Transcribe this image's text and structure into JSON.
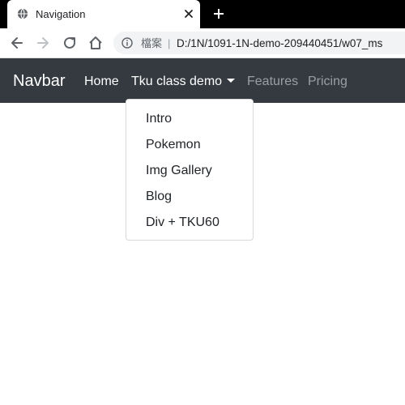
{
  "browser": {
    "tab": {
      "title": "Navigation",
      "favicon_icon": "globe-icon",
      "close_icon": "close-icon"
    },
    "new_tab_icon": "plus-icon",
    "toolbar": {
      "back_icon": "arrow-left-icon",
      "forward_icon": "arrow-right-icon",
      "reload_icon": "reload-icon",
      "home_icon": "home-icon"
    },
    "omnibox": {
      "info_icon": "info-icon",
      "label": "檔案",
      "separator": "|",
      "url": "D:/1N/1091-1N-demo-209440451/w07_ms"
    }
  },
  "navbar": {
    "brand": "Navbar",
    "background": "#343a40",
    "links": [
      {
        "label": "Home",
        "state": "active"
      },
      {
        "label": "Tku class demo",
        "state": "active",
        "dropdown": true
      },
      {
        "label": "Features",
        "state": "muted"
      },
      {
        "label": "Pricing",
        "state": "muted"
      }
    ]
  },
  "dropdown": {
    "open": true,
    "items": [
      "Intro",
      "Pokemon",
      "Img Gallery",
      "Blog",
      "Div + TKU60"
    ]
  }
}
